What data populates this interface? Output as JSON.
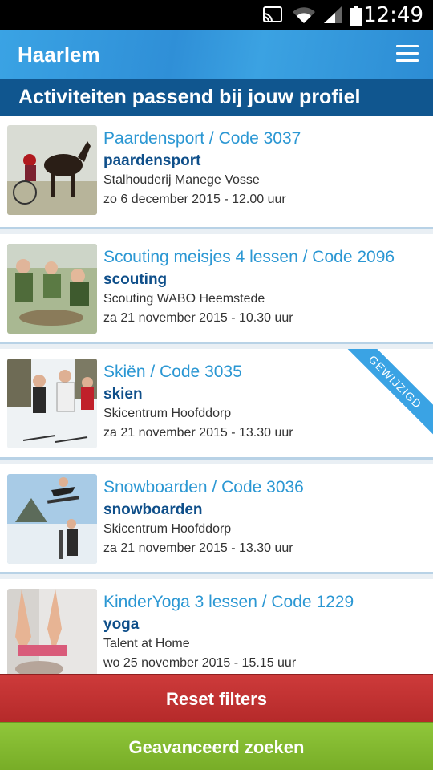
{
  "status_bar": {
    "time": "12:49"
  },
  "header": {
    "city": "Haarlem",
    "menu_icon": "menu-icon"
  },
  "subheader": {
    "title": "Activiteiten passend bij jouw profiel"
  },
  "activities": [
    {
      "title": "Paardensport / Code 3037",
      "category": "paardensport",
      "organizer": "Stalhouderij Manege Vosse",
      "date": "zo 6 december 2015 - 12.00 uur",
      "badge": ""
    },
    {
      "title": "Scouting meisjes 4 lessen / Code 2096",
      "category": "scouting",
      "organizer": "Scouting WABO Heemstede",
      "date": "za 21 november 2015 - 10.30 uur",
      "badge": ""
    },
    {
      "title": "Skiën / Code 3035",
      "category": "skien",
      "organizer": "Skicentrum Hoofddorp",
      "date": "za 21 november 2015 - 13.30 uur",
      "badge": "GEWIJZIGD"
    },
    {
      "title": "Snowboarden / Code 3036",
      "category": "snowboarden",
      "organizer": "Skicentrum Hoofddorp",
      "date": "za 21 november 2015 - 13.30 uur",
      "badge": ""
    },
    {
      "title": "KinderYoga 3 lessen / Code 1229",
      "category": "yoga",
      "organizer": "Talent at Home",
      "date": "wo 25 november 2015 - 15.15 uur",
      "badge": ""
    }
  ],
  "buttons": {
    "reset": "Reset filters",
    "advanced": "Geavanceerd zoeken"
  },
  "colors": {
    "primary": "#2f8fd7",
    "dark_blue": "#10568f",
    "reset": "#c03232",
    "advanced": "#84b930"
  }
}
